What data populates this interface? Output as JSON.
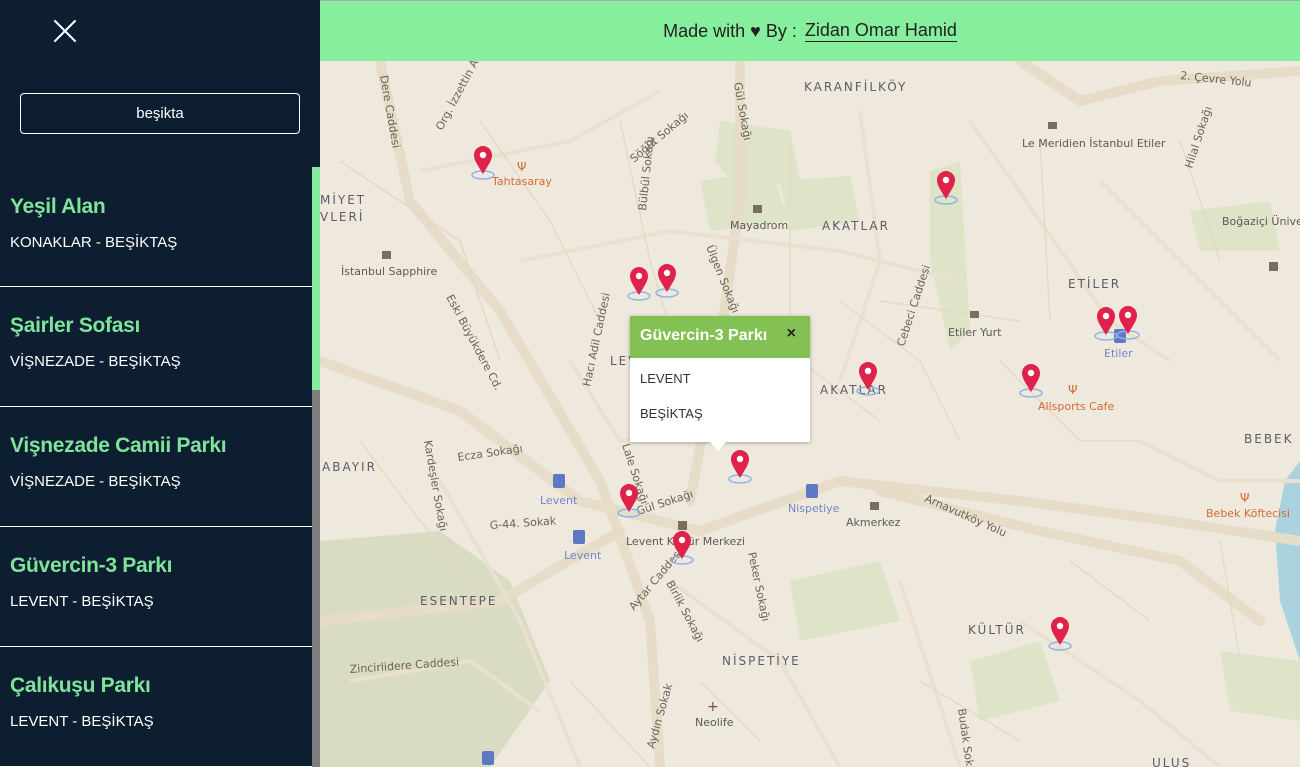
{
  "sidebar": {
    "search": {
      "value": "beşikta",
      "placeholder": ""
    },
    "parks": [
      {
        "name": "Yeşil Alan",
        "location": "KONAKLAR - BEŞİKTAŞ"
      },
      {
        "name": "Şairler Sofası",
        "location": "VİŞNEZADE - BEŞİKTAŞ"
      },
      {
        "name": "Vişnezade Camii Parkı",
        "location": "VİŞNEZADE - BEŞİKTAŞ"
      },
      {
        "name": "Güvercin-3 Parkı",
        "location": "LEVENT - BEŞİKTAŞ"
      },
      {
        "name": "Çalıkuşu Parkı",
        "location": "LEVENT - BEŞİKTAŞ"
      }
    ]
  },
  "banner": {
    "prefix": "Made with ♥ By :",
    "author": "Zidan Omar Hamid"
  },
  "popup": {
    "title": "Güvercin-3 Parkı",
    "close": "×",
    "neighborhood": "LEVENT",
    "district": "BEŞİKTAŞ"
  },
  "map": {
    "districts": [
      "KARANFİLKÖY",
      "AKATLAR",
      "ETİLER",
      "LEVENT",
      "AKATLAR",
      "BEBEK",
      "ESENTEPE",
      "KÜLTÜR",
      "NİSPETİYE",
      "ABAYIR",
      "MİYET",
      "VLERİ",
      "ULUS"
    ],
    "streets": [
      "Dere Caddesi",
      "Org. İzzettin Aksalur",
      "Gül Sokağı",
      "Söğüt Sokağı",
      "Bülbül Sokağı",
      "Ülgen Sokağı",
      "Cebeci Caddesi",
      "Hacı Adil Caddesi",
      "Eski Büyükdere Cd.",
      "Kardeşler Sokağı",
      "Ecza Sokağı",
      "G-44. Sokak",
      "Lale Sokağı",
      "Gül Sokağı",
      "Aytar Caddesi",
      "Birlik Sokağı",
      "Peker Sokağı",
      "Arnavutköy Yolu",
      "Zincirlidere Caddesi",
      "Aydın Sokak",
      "Budak Sokağı",
      "2. Çevre Yolu",
      "Hilal Sokağı"
    ],
    "pois": [
      "Le Meridien İstanbul Etiler",
      "Boğaziçi Üniversitesi Kuzey Kampüsü",
      "Mayadrom",
      "İstanbul Sapphire",
      "Etiler Yurt",
      "Levent Kültür Merkezi",
      "Akmerkez",
      "Neolife"
    ],
    "food": [
      "Tahtasaray",
      "Allsports Cafe",
      "Bebek Köftecisi"
    ],
    "transit": [
      "Levent",
      "Levent",
      "Nispetiye",
      "Etiler"
    ],
    "marker_color": "#e0224b"
  }
}
